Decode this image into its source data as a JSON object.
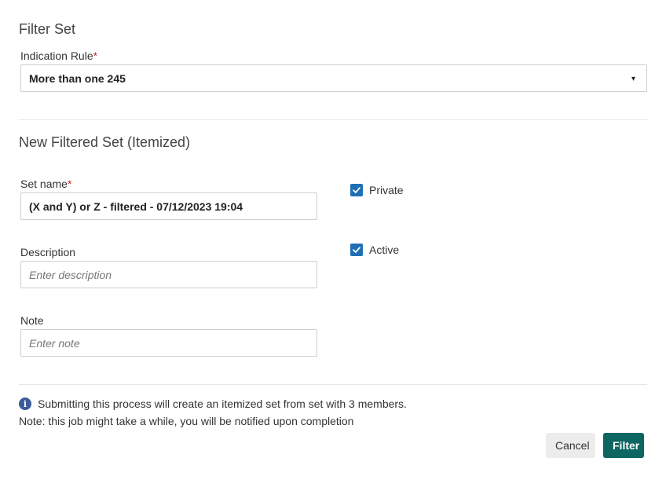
{
  "filter_set": {
    "title": "Filter Set",
    "indication_rule_label": "Indication Rule",
    "required_mark": "*",
    "indication_rule_value": "More than one 245",
    "dropdown_caret": "▾"
  },
  "new_set": {
    "title": "New Filtered Set (Itemized)",
    "set_name_label": "Set name",
    "set_name_value": "(X and Y) or Z - filtered - 07/12/2023 19:04",
    "description_label": "Description",
    "description_placeholder": "Enter description",
    "note_label": "Note",
    "note_placeholder": "Enter note",
    "private_label": "Private",
    "private_checked": true,
    "active_label": "Active",
    "active_checked": true
  },
  "footer": {
    "info_text": "Submitting this process will create an itemized set from set with 3 members.",
    "note_text": "Note: this job might take a while, you will be notified upon completion",
    "cancel_label": "Cancel",
    "filter_label": "Filter"
  },
  "colors": {
    "primary": "#0d6661",
    "checkbox": "#1e6fb5",
    "required": "#c62828",
    "info_icon": "#3b5b9a"
  },
  "icons": {
    "checkbox_checked": "check-icon",
    "info": "info-icon",
    "dropdown": "chevron-down-icon"
  }
}
